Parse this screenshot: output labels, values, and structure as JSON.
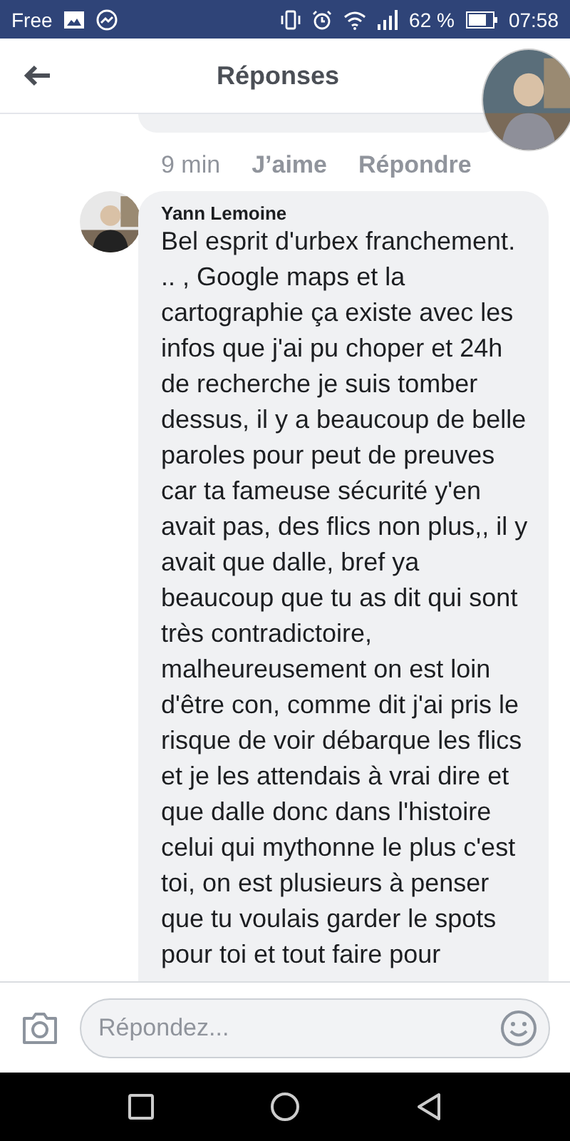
{
  "status_bar": {
    "carrier": "Free",
    "battery": "62 %",
    "time": "07:58"
  },
  "header": {
    "title": "Réponses"
  },
  "previous_comment": {
    "time": "9 min",
    "like": "J’aime",
    "reply": "Répondre"
  },
  "comment": {
    "author": "Yann Lemoine",
    "text": "Bel esprit d'urbex franchement. .. , Google maps et la cartographie ça existe avec les infos que j'ai pu choper et 24h de recherche je suis tomber dessus, il y a beaucoup de belle paroles pour peut de preuves car ta fameuse sécurité y'en avait pas, des flics non plus,, il y avait que dalle, bref ya beaucoup que tu as dit qui sont très contradictoire, malheureusement on est loin d'être con, comme dit j'ai pris le risque de voir débarque les flics et je les attendais à vrai dire et que dalle donc dans l'histoire celui qui mythonne le plus c'est toi, on est plusieurs à penser que tu voulais garder le spots pour toi et tout faire pour"
  },
  "composer": {
    "placeholder": "Répondez..."
  }
}
